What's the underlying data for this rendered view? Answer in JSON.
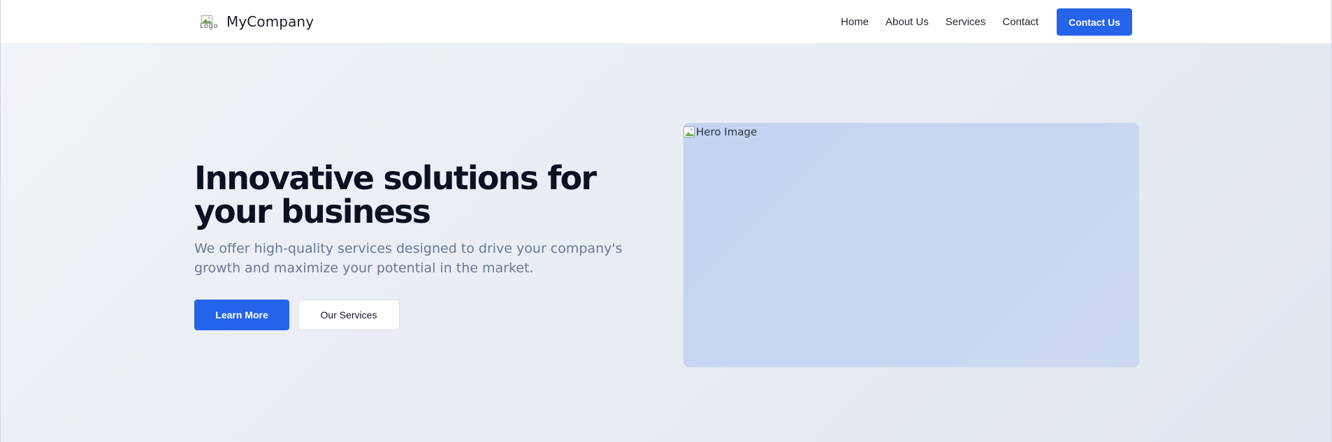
{
  "header": {
    "logo_alt": "Logo",
    "brand_name": "MyCompany",
    "nav": [
      {
        "label": "Home"
      },
      {
        "label": "About Us"
      },
      {
        "label": "Services"
      },
      {
        "label": "Contact"
      }
    ],
    "cta_label": "Contact Us"
  },
  "hero": {
    "title": "Innovative solutions for your business",
    "subtitle": "We offer high-quality services designed to drive your company's growth and maximize your potential in the market.",
    "primary_button": "Learn More",
    "secondary_button": "Our Services",
    "image_alt": "Hero Image"
  },
  "colors": {
    "accent": "#2563eb",
    "title": "#0b1120",
    "subtitle": "#6b7890",
    "hero_bg": "#e9edf4",
    "image_placeholder": "#c8d6f1"
  },
  "icons": {
    "logo": "broken-image-icon",
    "hero_image": "broken-image-icon"
  }
}
